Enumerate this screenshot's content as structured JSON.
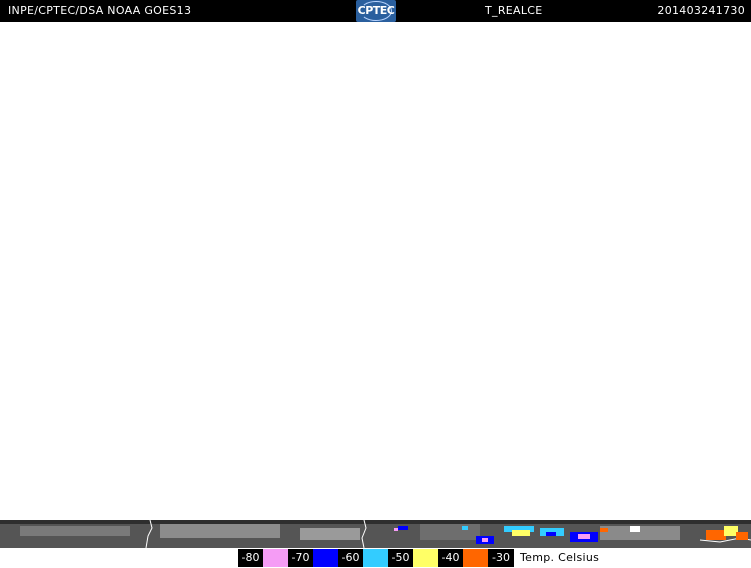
{
  "header": {
    "source": "INPE/CPTEC/DSA NOAA GOES13",
    "product": "T_REALCE",
    "timestamp": "201403241730",
    "logo_text": "CPTEC"
  },
  "legend": {
    "caption": "Temp. Celsius",
    "entries": [
      {
        "label": "-80",
        "color": "#f59cf5"
      },
      {
        "label": "-70",
        "color": "#0000ff"
      },
      {
        "label": "-60",
        "color": "#33ccff"
      },
      {
        "label": "-50",
        "color": "#ffff66"
      },
      {
        "label": "-40",
        "color": "#ff6600"
      },
      {
        "label": "-30",
        "color": null
      }
    ]
  },
  "colors": {
    "bar": "#000000",
    "background": "#ffffff",
    "logo": "#2a5f9e"
  }
}
